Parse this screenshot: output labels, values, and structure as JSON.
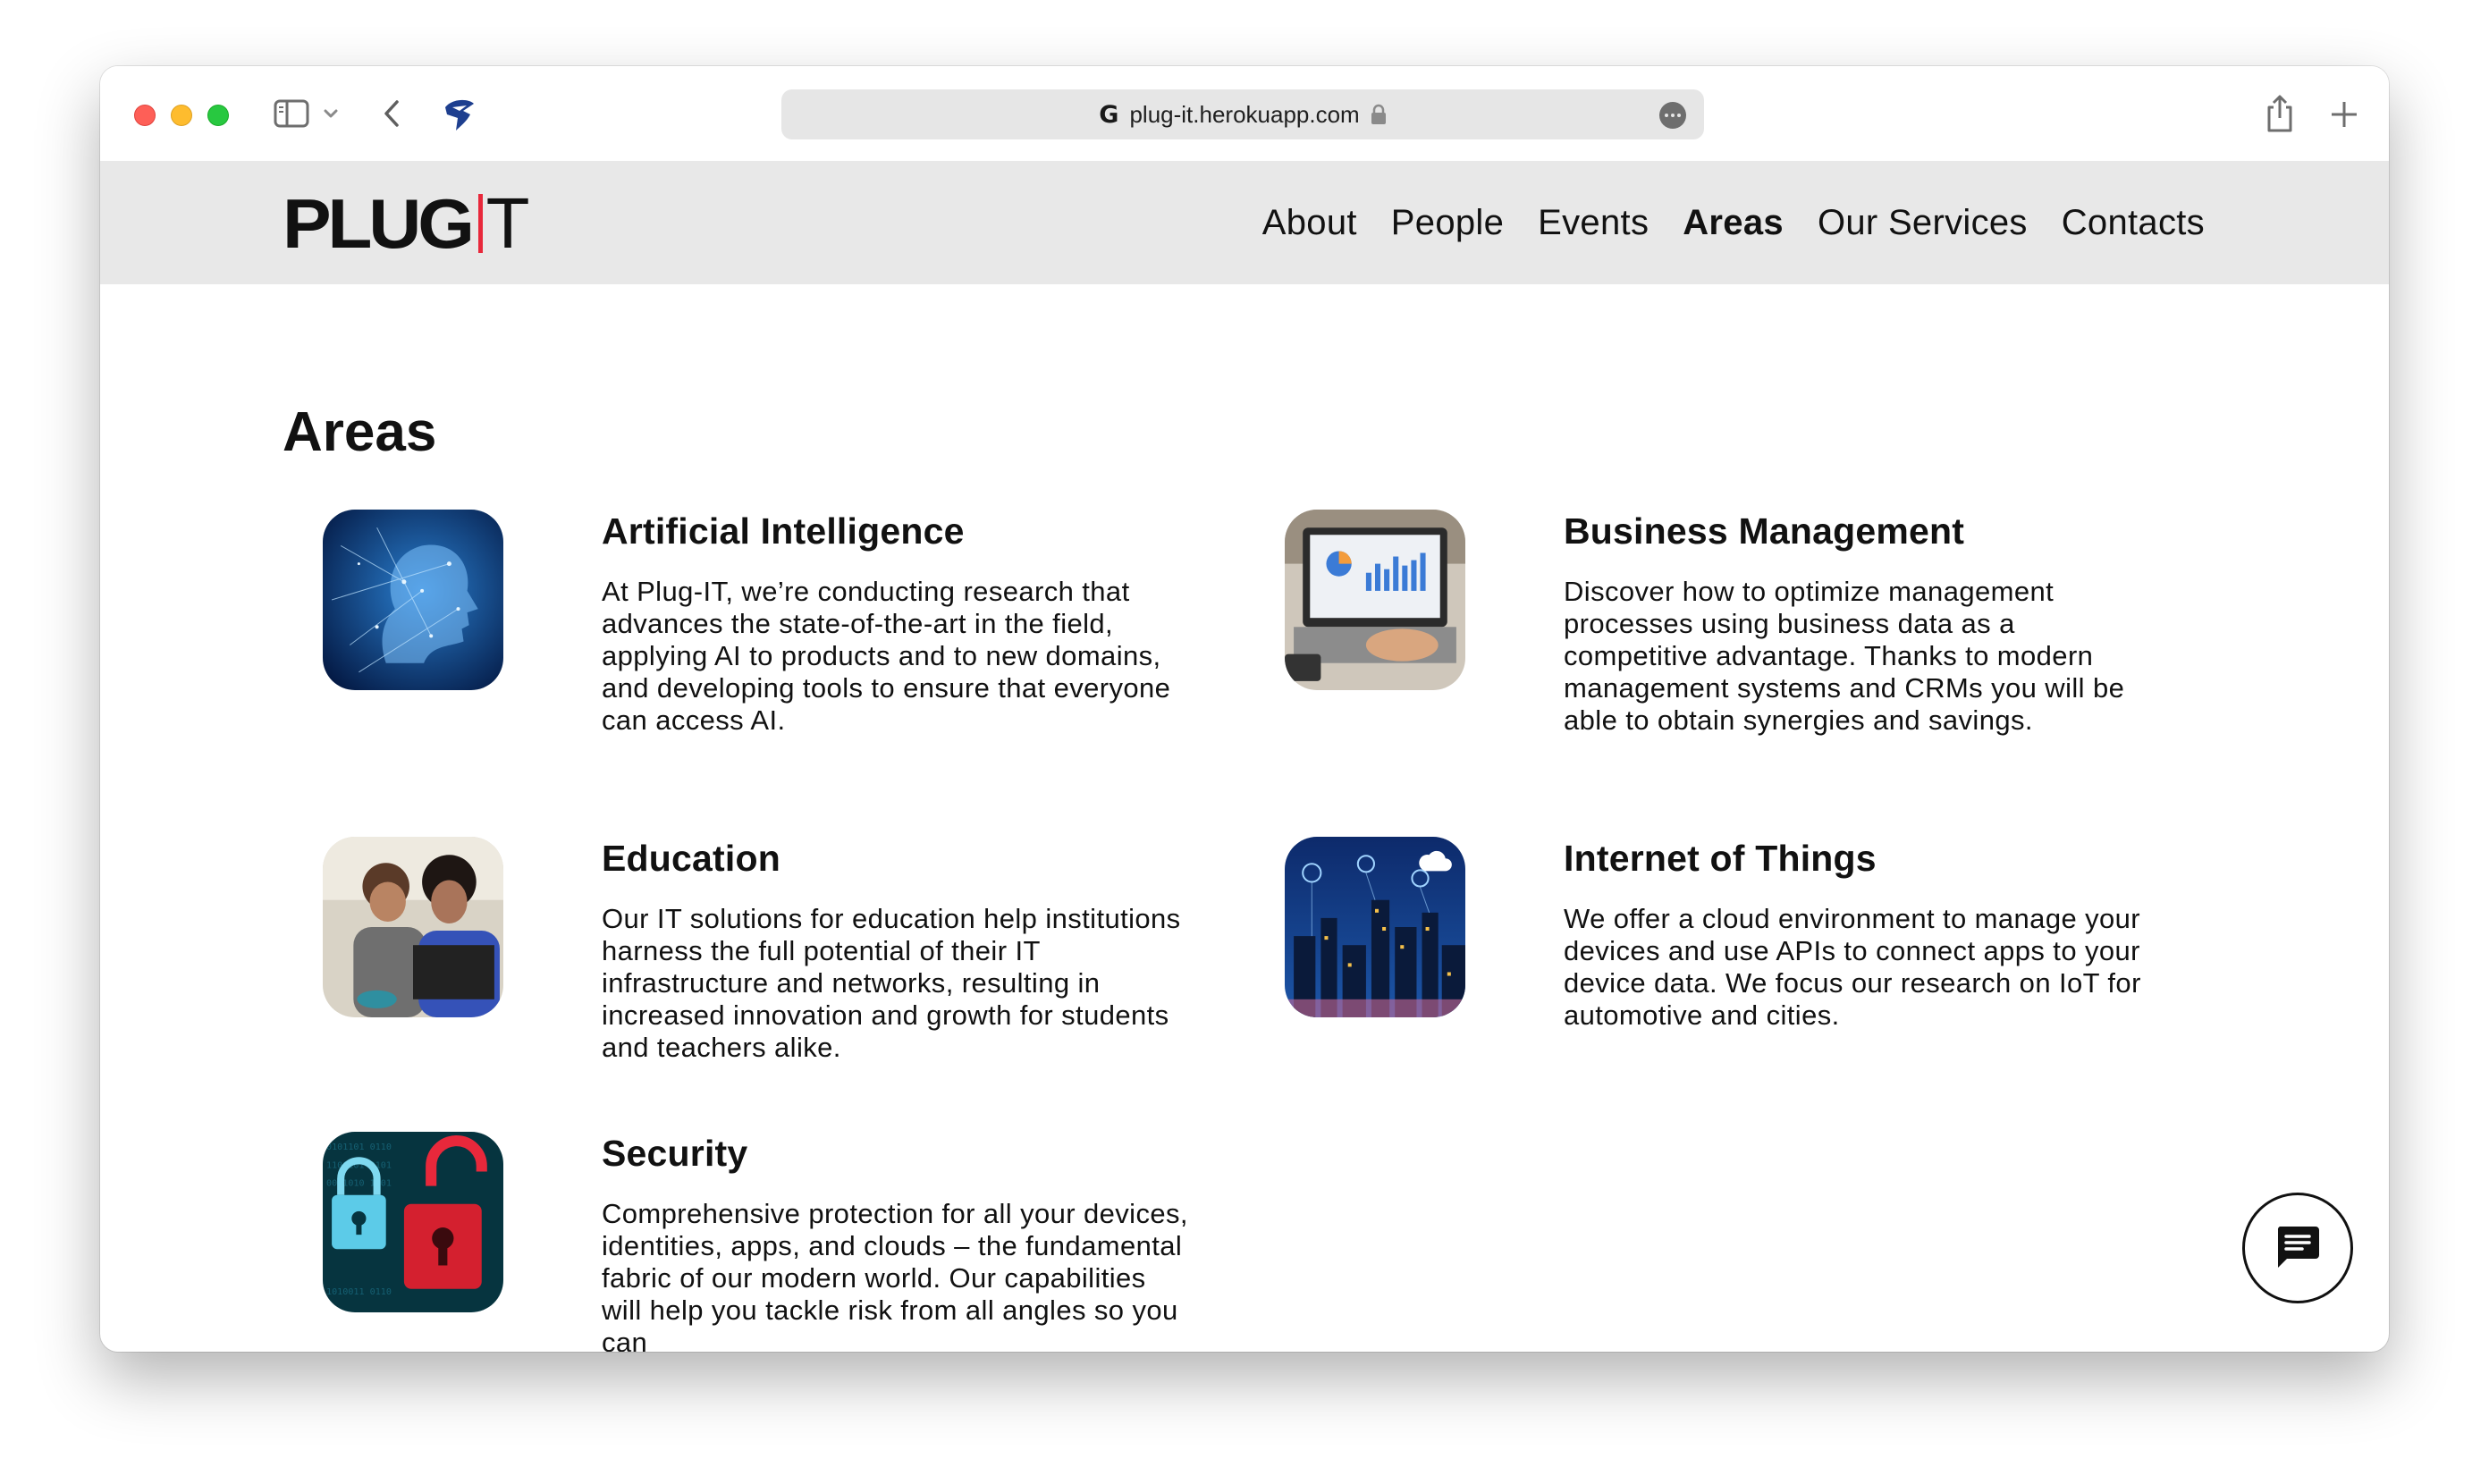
{
  "browser": {
    "url": "plug-it.herokuapp.com",
    "icons": [
      "sidebar-icon",
      "chevron-down-icon",
      "back-icon",
      "site-favicon-icon",
      "google-icon",
      "lock-icon",
      "more-icon",
      "share-icon",
      "plus-icon"
    ]
  },
  "header": {
    "logo_bold": "PLUG",
    "logo_light": "T",
    "logo_accent_color": "#e8283b",
    "nav": [
      {
        "label": "About"
      },
      {
        "label": "People"
      },
      {
        "label": "Events"
      },
      {
        "label": "Areas",
        "active": true
      },
      {
        "label": "Our Services"
      },
      {
        "label": "Contacts"
      }
    ]
  },
  "main": {
    "title": "Areas",
    "areas": [
      {
        "title": "Artificial Intelligence",
        "description": "At Plug-IT, we’re conducting research that advances the state-of-the-art in the field, applying AI to products and to new domains, and developing tools to ensure that everyone can access AI."
      },
      {
        "title": "Business Management",
        "description": "Discover how to optimize management processes using business data as a competitive advantage. Thanks to modern management systems and CRMs you will be able to obtain synergies and savings."
      },
      {
        "title": "Education",
        "description": "Our IT solutions for education help institutions harness the full potential of their IT infrastructure and networks, resulting in increased innovation and growth for students and teachers alike."
      },
      {
        "title": "Internet of Things",
        "description": "We offer a cloud environment to manage your devices and use APIs to connect apps to your device data. We focus our research on IoT for automotive and cities."
      },
      {
        "title": "Security",
        "description": "Comprehensive protection for all your devices, identities, apps, and clouds – the fundamental fabric of our modern world. Our capabilities will help you tackle risk from all angles so you can"
      }
    ]
  },
  "chat": {
    "icon": "chat-icon"
  }
}
